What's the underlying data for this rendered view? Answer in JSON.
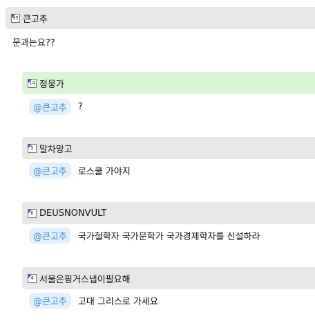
{
  "post": {
    "author_badge": "95",
    "author": "큰고추",
    "content": "문과는요??"
  },
  "replies": [
    {
      "badge": "14",
      "author": "정뭉가",
      "mention": "@큰고추",
      "text": "?",
      "header_color": "#dbf5d9"
    },
    {
      "badge": "5",
      "author": "말차망고",
      "mention": "@큰고추",
      "text": "로스쿨 가야지",
      "header_color": "#e8e8e8"
    },
    {
      "badge": "6",
      "author": "DEUSNONVULT",
      "mention": "@큰고추",
      "text": "국가철학자 국가문학가 국가경제학자를 신설하라",
      "header_color": "#e8e8e8"
    },
    {
      "badge": "4",
      "author": "서울은핑거스냅이필요해",
      "mention": "@큰고추",
      "text": "고대 그리스로 가세요",
      "header_color": "#e8e8e8"
    }
  ]
}
